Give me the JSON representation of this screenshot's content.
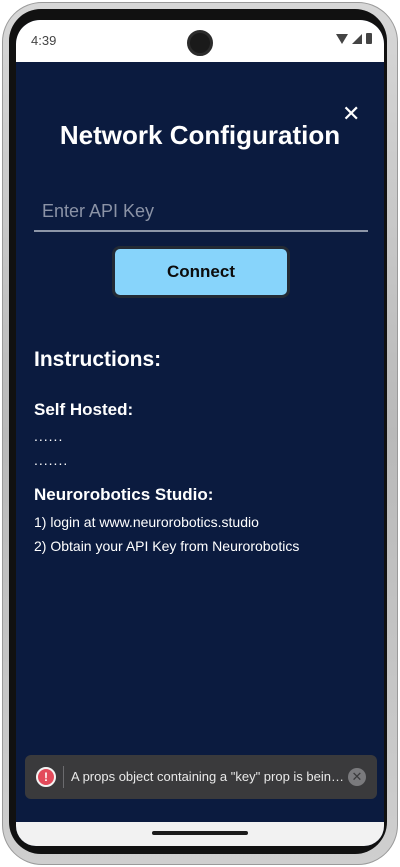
{
  "status_bar": {
    "time": "4:39",
    "icons": [
      "wifi-icon",
      "signal-icon",
      "battery-icon"
    ]
  },
  "dialog": {
    "title": "Network Configuration",
    "close_icon": "close-icon",
    "close_glyph": "✕"
  },
  "api_input": {
    "placeholder": "Enter API Key",
    "value": ""
  },
  "connect_button": {
    "label": "Connect"
  },
  "instructions": {
    "heading": "Instructions:",
    "self_hosted": {
      "heading": "Self Hosted:",
      "lines": [
        "......",
        "......."
      ]
    },
    "studio": {
      "heading": "Neurorobotics Studio:",
      "steps": [
        "1) login at www.neurorobotics.studio",
        "2) Obtain your API Key from Neurorobotics"
      ]
    }
  },
  "toast": {
    "icon": "error-icon",
    "icon_glyph": "!",
    "message": "A props object containing a \"key\" prop is being spread into JSX",
    "close_glyph": "✕"
  },
  "colors": {
    "background": "#0b1b3f",
    "accent": "#87d4fb",
    "error": "#e34a5b"
  }
}
